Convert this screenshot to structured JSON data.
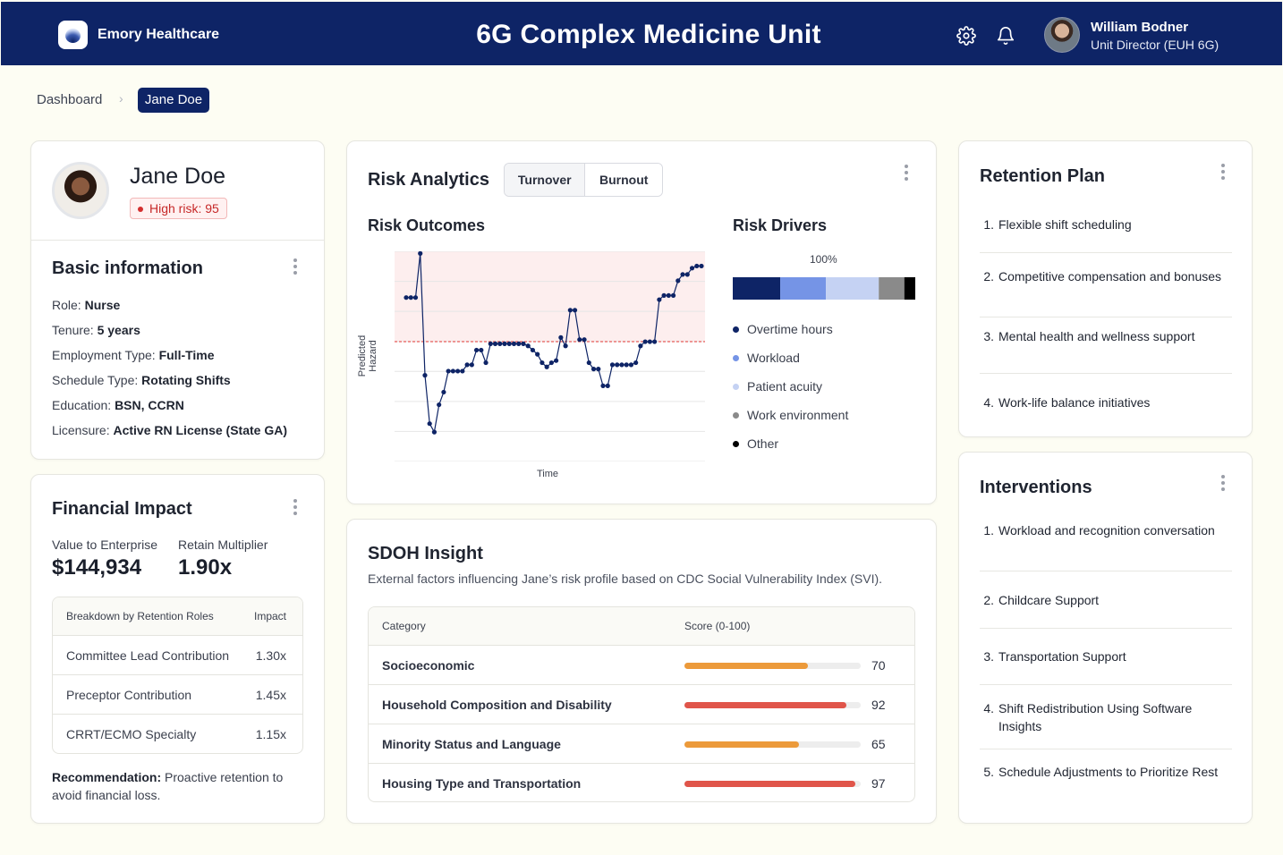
{
  "header": {
    "brand": "Emory Healthcare",
    "title": "6G Complex Medicine Unit",
    "user_name": "William Bodner",
    "user_role": "Unit Director (EUH 6G)"
  },
  "breadcrumb": {
    "items": [
      "Dashboard",
      "Jane Doe"
    ]
  },
  "profile": {
    "name": "Jane Doe",
    "risk_badge": "High risk: 95",
    "basic_title": "Basic information",
    "fields": [
      {
        "label": "Role:",
        "value": "Nurse"
      },
      {
        "label": "Tenure:",
        "value": "5 years"
      },
      {
        "label": "Employment Type:",
        "value": "Full-Time"
      },
      {
        "label": "Schedule Type:",
        "value": "Rotating Shifts"
      },
      {
        "label": "Education:",
        "value": "BSN, CCRN"
      },
      {
        "label": "Licensure:",
        "value": "Active RN License (State GA)"
      }
    ]
  },
  "financial": {
    "title": "Financial Impact",
    "value_label": "Value to Enterprise",
    "value": "$144,934",
    "multiplier_label": "Retain Multiplier",
    "multiplier": "1.90x",
    "table_headers": [
      "Breakdown by Retention Roles",
      "Impact"
    ],
    "rows": [
      {
        "role": "Committee Lead Contribution",
        "impact": "1.30x"
      },
      {
        "role": "Preceptor Contribution",
        "impact": "1.45x"
      },
      {
        "role": "CRRT/ECMO Specialty",
        "impact": "1.15x"
      }
    ],
    "recommendation_label": "Recommendation:",
    "recommendation_text": " Proactive retention to avoid financial loss."
  },
  "risk_analytics": {
    "title": "Risk Analytics",
    "tabs": [
      "Turnover",
      "Burnout"
    ],
    "active_tab": "Turnover",
    "outcomes_title": "Risk Outcomes",
    "drivers_title": "Risk Drivers",
    "drivers_total": "100%",
    "accent_threshold_color": "#e53935"
  },
  "chart_data": [
    {
      "type": "line",
      "title": "Risk Outcomes",
      "xlabel": "Time",
      "ylabel": "Predicted Hazard",
      "ylim": [
        0,
        1
      ],
      "threshold": 0.57,
      "grid": true,
      "color": "#0e2466",
      "values": [
        0.78,
        0.78,
        0.78,
        0.99,
        0.41,
        0.18,
        0.14,
        0.27,
        0.33,
        0.43,
        0.43,
        0.43,
        0.43,
        0.46,
        0.46,
        0.53,
        0.53,
        0.47,
        0.56,
        0.56,
        0.56,
        0.56,
        0.56,
        0.56,
        0.56,
        0.56,
        0.55,
        0.53,
        0.51,
        0.47,
        0.45,
        0.47,
        0.48,
        0.59,
        0.55,
        0.72,
        0.72,
        0.58,
        0.58,
        0.47,
        0.44,
        0.44,
        0.36,
        0.36,
        0.46,
        0.46,
        0.46,
        0.46,
        0.46,
        0.47,
        0.55,
        0.57,
        0.57,
        0.57,
        0.77,
        0.79,
        0.79,
        0.79,
        0.86,
        0.89,
        0.89,
        0.92,
        0.93,
        0.93
      ]
    },
    {
      "type": "bar",
      "title": "Risk Drivers",
      "total_label": "100%",
      "stacked": true,
      "series": [
        {
          "name": "Overtime hours",
          "value": 26,
          "color": "#0e2466"
        },
        {
          "name": "Workload",
          "value": 25,
          "color": "#7594e6"
        },
        {
          "name": "Patient acuity",
          "value": 29,
          "color": "#c5d2f3"
        },
        {
          "name": "Work environment",
          "value": 14,
          "color": "#8a8a8a"
        },
        {
          "name": "Other",
          "value": 6,
          "color": "#000000"
        }
      ]
    }
  ],
  "sdoh": {
    "title": "SDOH Insight",
    "description": "External factors influencing Jane’s risk profile based on CDC Social Vulnerability Index (SVI).",
    "headers": [
      "Category",
      "Score (0-100)"
    ],
    "rows": [
      {
        "category": "Socioeconomic",
        "score": "70",
        "value": 70,
        "color": "#ec9a3a"
      },
      {
        "category": "Household Composition and Disability",
        "score": "92",
        "value": 92,
        "color": "#e0554a"
      },
      {
        "category": "Minority Status and Language",
        "score": "65",
        "value": 65,
        "color": "#ec9a3a"
      },
      {
        "category": "Housing Type and Transportation",
        "score": "97",
        "value": 97,
        "color": "#e0554a"
      }
    ]
  },
  "retention_plan": {
    "title": "Retention Plan",
    "items": [
      {
        "num": "1.",
        "text": "Flexible shift scheduling"
      },
      {
        "num": "2.",
        "text": "Competitive compensation and bonuses"
      },
      {
        "num": "3.",
        "text": "Mental health and wellness support"
      },
      {
        "num": "4.",
        "text": "Work-life balance initiatives"
      }
    ]
  },
  "interventions": {
    "title": "Interventions",
    "items": [
      {
        "num": "1.",
        "text": "Workload and recognition conversation"
      },
      {
        "num": "2.",
        "text": "Childcare Support"
      },
      {
        "num": "3.",
        "text": "Transportation Support"
      },
      {
        "num": "4.",
        "text": "Shift Redistribution Using Software Insights"
      },
      {
        "num": "5.",
        "text": "Schedule Adjustments to Prioritize Rest"
      }
    ]
  }
}
